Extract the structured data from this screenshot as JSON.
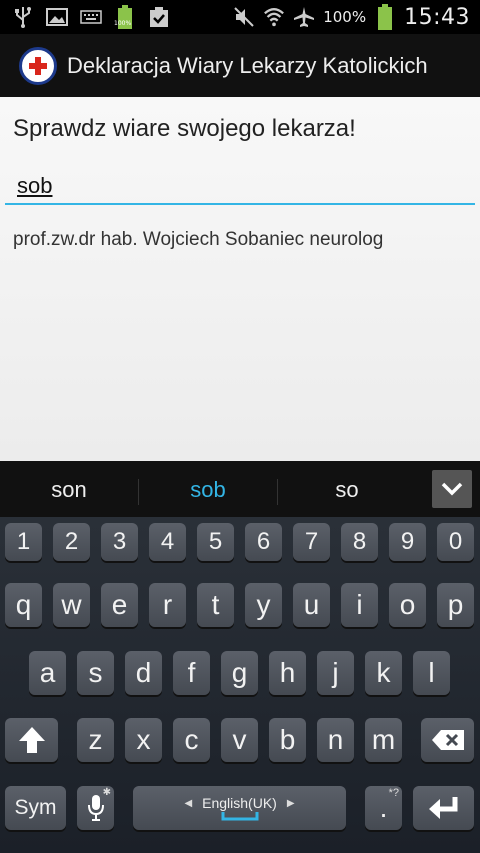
{
  "status_bar": {
    "battery_percent": "100%",
    "time": "15:43",
    "icons": [
      "usb-icon",
      "image-icon",
      "keyboard-icon",
      "battery-small-icon",
      "clipboard-check-icon",
      "mute-icon",
      "wifi-icon",
      "airplane-icon",
      "battery-icon"
    ],
    "mini_battery_label": "100%"
  },
  "app_bar": {
    "title": "Deklaracja Wiary Lekarzy Katolickich"
  },
  "main": {
    "heading": "Sprawdz wiare swojego lekarza!",
    "search_value": "sob",
    "results": [
      "prof.zw.dr hab. Wojciech Sobaniec neurolog"
    ]
  },
  "suggestions": {
    "items": [
      "son",
      "sob",
      "so"
    ],
    "active_index": 1
  },
  "keyboard": {
    "row_numbers": [
      "1",
      "2",
      "3",
      "4",
      "5",
      "6",
      "7",
      "8",
      "9",
      "0"
    ],
    "row_q": [
      "q",
      "w",
      "e",
      "r",
      "t",
      "y",
      "u",
      "i",
      "o",
      "p"
    ],
    "row_a": [
      "a",
      "s",
      "d",
      "f",
      "g",
      "h",
      "j",
      "k",
      "l"
    ],
    "row_z": [
      "z",
      "x",
      "c",
      "v",
      "b",
      "n",
      "m"
    ],
    "sym_label": "Sym",
    "language_label": "English(UK)",
    "period_label": ".",
    "period_hint": "*?",
    "colors": {
      "accent": "#33b5e5",
      "key_bg": "#50555d"
    }
  }
}
